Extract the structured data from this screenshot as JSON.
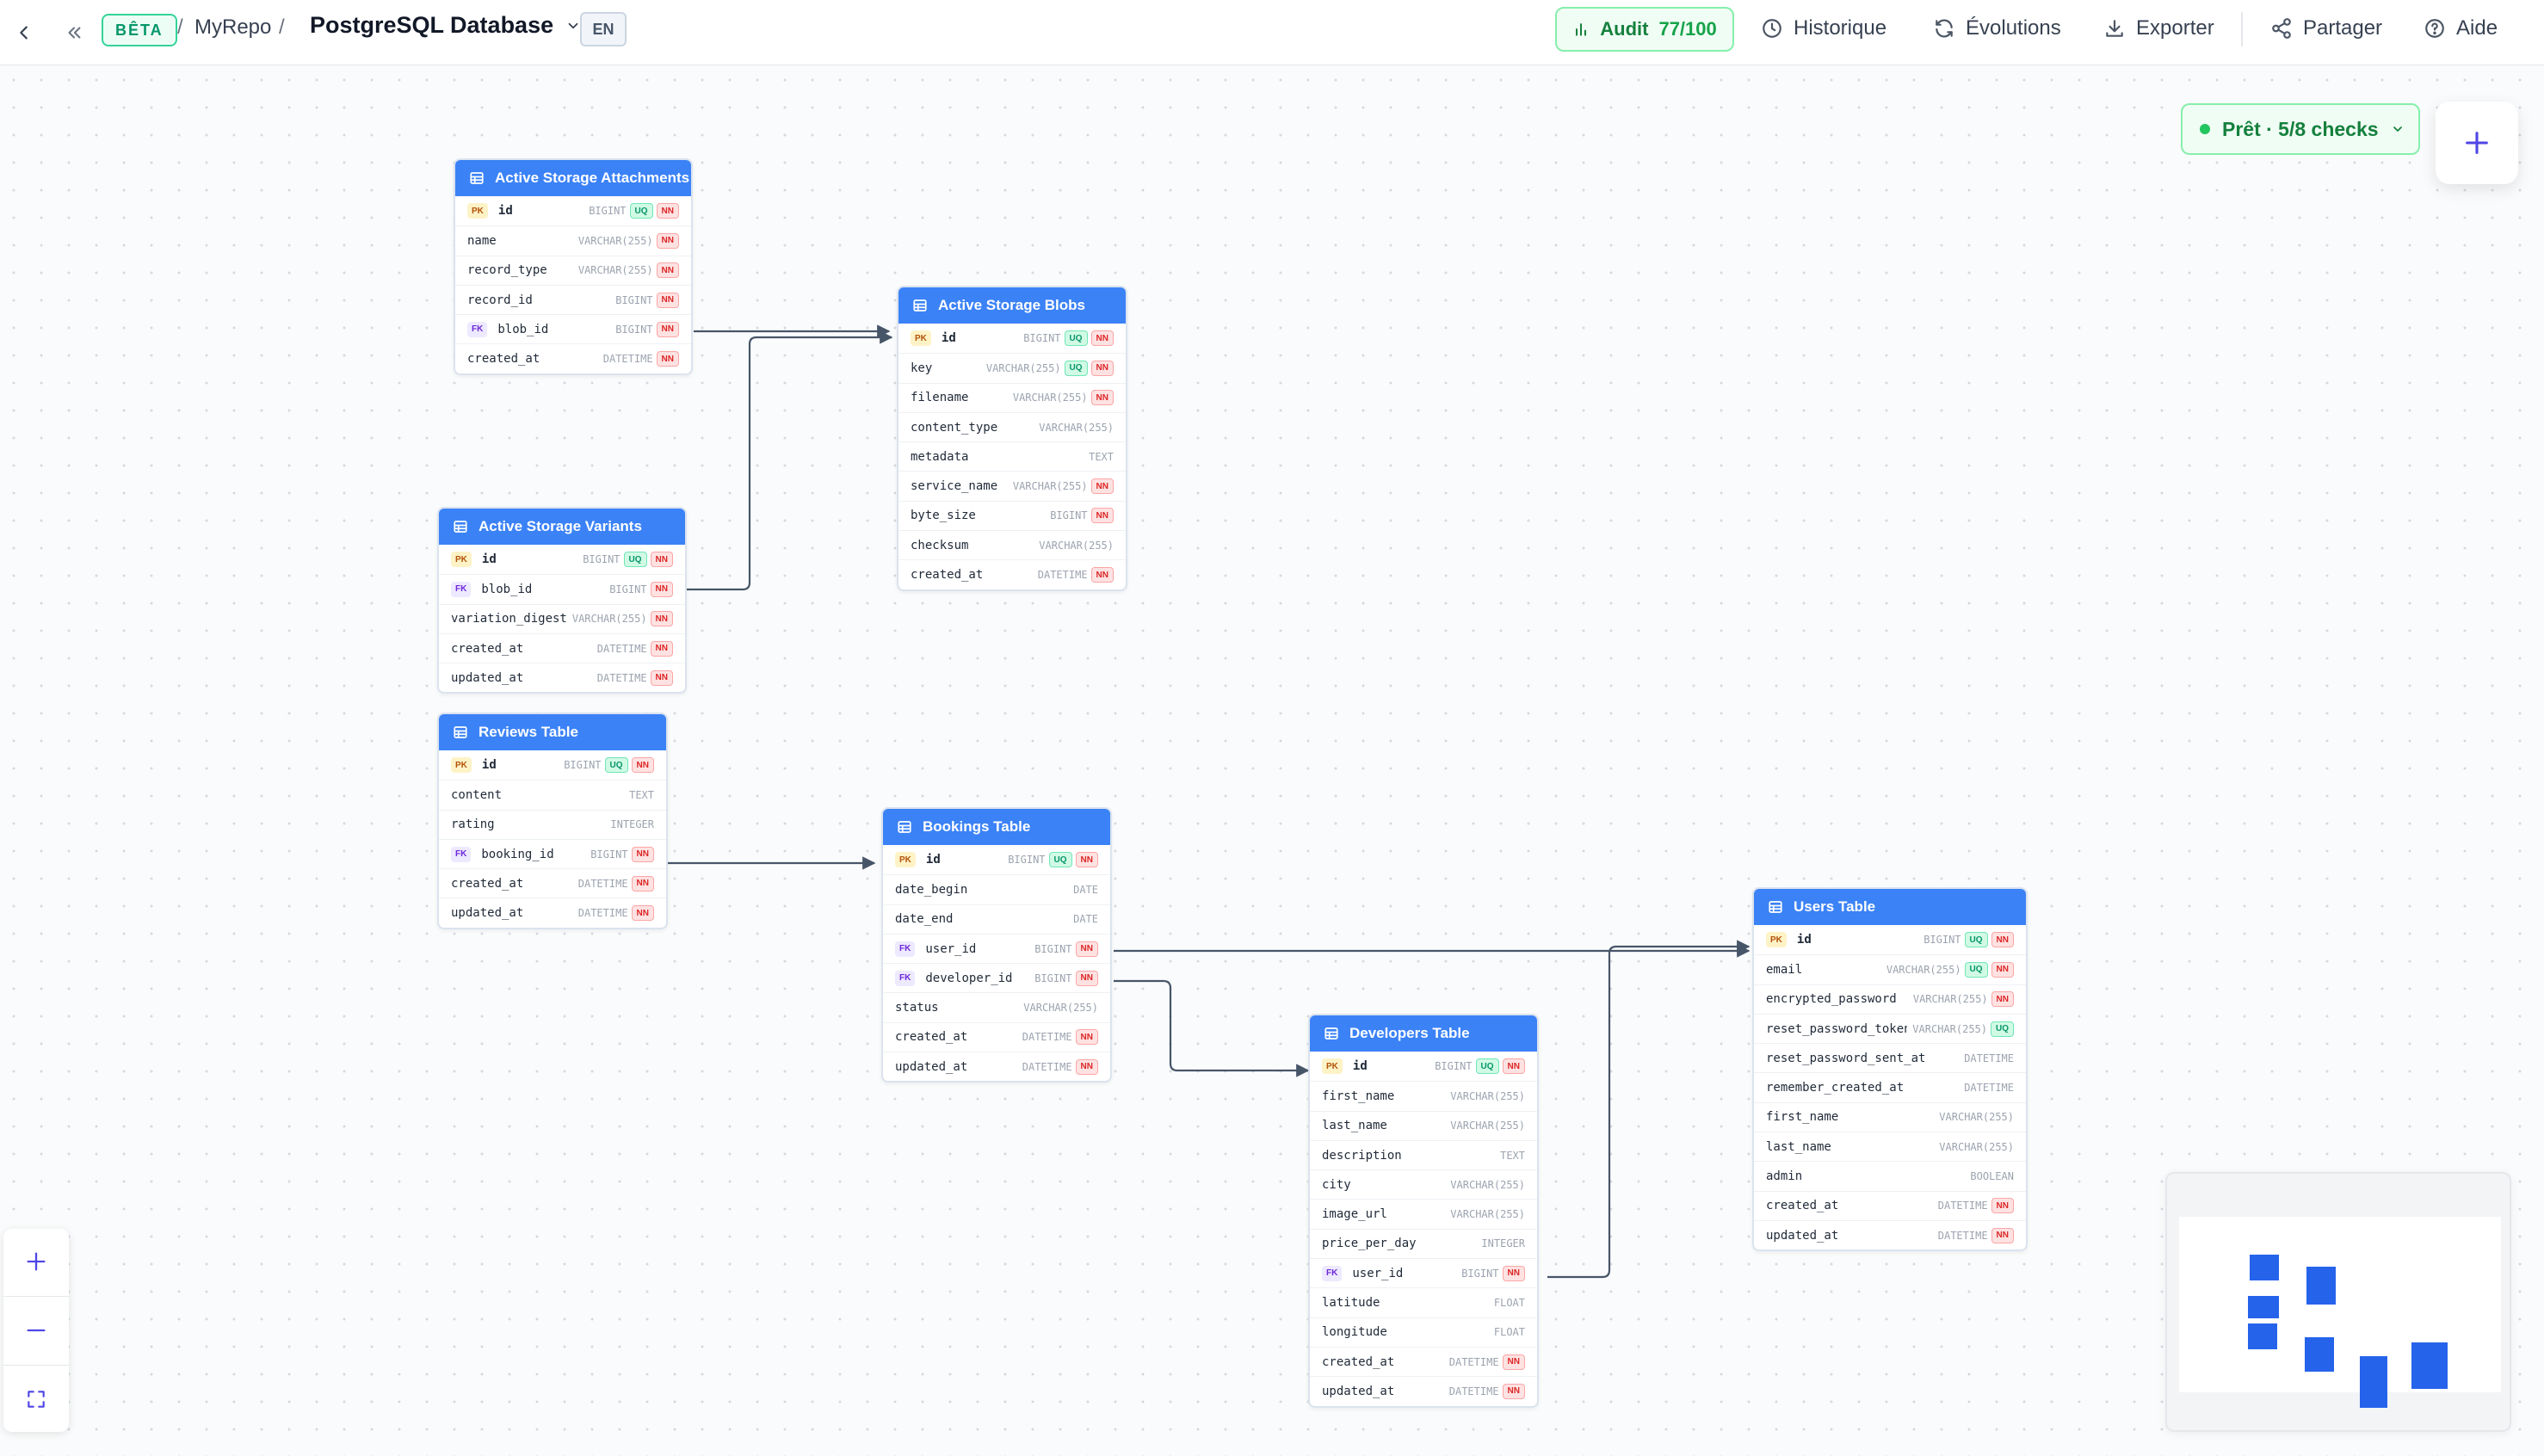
{
  "header": {
    "beta_label": "BÊTA",
    "separator": "/",
    "repo": "MyRepo",
    "database": "PostgreSQL Database",
    "language": "EN",
    "audit_label": "Audit",
    "audit_score": "77/100",
    "actions": {
      "history": "Historique",
      "evolutions": "Évolutions",
      "export": "Exporter",
      "share": "Partager",
      "help": "Aide"
    }
  },
  "status": {
    "label": "Prêt · 5/8 checks"
  },
  "colors": {
    "table_header": "#3b82f6",
    "edge": "#475569",
    "status_green": "#15803d",
    "accent": "#2563eb"
  },
  "tables": {
    "attachments": {
      "title": "Active Storage Attachments",
      "columns": [
        {
          "name": "id",
          "type": "BIGINT",
          "key": "PK",
          "badges": [
            "UQ",
            "NN"
          ]
        },
        {
          "name": "name",
          "type": "VARCHAR(255)",
          "key": "",
          "badges": [
            "NN"
          ]
        },
        {
          "name": "record_type",
          "type": "VARCHAR(255)",
          "key": "",
          "badges": [
            "NN"
          ]
        },
        {
          "name": "record_id",
          "type": "BIGINT",
          "key": "",
          "badges": [
            "NN"
          ]
        },
        {
          "name": "blob_id",
          "type": "BIGINT",
          "key": "FK",
          "badges": [
            "NN"
          ]
        },
        {
          "name": "created_at",
          "type": "DATETIME",
          "key": "",
          "badges": [
            "NN"
          ]
        }
      ]
    },
    "blobs": {
      "title": "Active Storage Blobs",
      "columns": [
        {
          "name": "id",
          "type": "BIGINT",
          "key": "PK",
          "badges": [
            "UQ",
            "NN"
          ]
        },
        {
          "name": "key",
          "type": "VARCHAR(255)",
          "key": "",
          "badges": [
            "UQ",
            "NN"
          ]
        },
        {
          "name": "filename",
          "type": "VARCHAR(255)",
          "key": "",
          "badges": [
            "NN"
          ]
        },
        {
          "name": "content_type",
          "type": "VARCHAR(255)",
          "key": "",
          "badges": []
        },
        {
          "name": "metadata",
          "type": "TEXT",
          "key": "",
          "badges": []
        },
        {
          "name": "service_name",
          "type": "VARCHAR(255)",
          "key": "",
          "badges": [
            "NN"
          ]
        },
        {
          "name": "byte_size",
          "type": "BIGINT",
          "key": "",
          "badges": [
            "NN"
          ]
        },
        {
          "name": "checksum",
          "type": "VARCHAR(255)",
          "key": "",
          "badges": []
        },
        {
          "name": "created_at",
          "type": "DATETIME",
          "key": "",
          "badges": [
            "NN"
          ]
        }
      ]
    },
    "variants": {
      "title": "Active Storage Variants",
      "columns": [
        {
          "name": "id",
          "type": "BIGINT",
          "key": "PK",
          "badges": [
            "UQ",
            "NN"
          ]
        },
        {
          "name": "blob_id",
          "type": "BIGINT",
          "key": "FK",
          "badges": [
            "NN"
          ]
        },
        {
          "name": "variation_digest",
          "type": "VARCHAR(255)",
          "key": "",
          "badges": [
            "NN"
          ]
        },
        {
          "name": "created_at",
          "type": "DATETIME",
          "key": "",
          "badges": [
            "NN"
          ]
        },
        {
          "name": "updated_at",
          "type": "DATETIME",
          "key": "",
          "badges": [
            "NN"
          ]
        }
      ]
    },
    "reviews": {
      "title": "Reviews Table",
      "columns": [
        {
          "name": "id",
          "type": "BIGINT",
          "key": "PK",
          "badges": [
            "UQ",
            "NN"
          ]
        },
        {
          "name": "content",
          "type": "TEXT",
          "key": "",
          "badges": []
        },
        {
          "name": "rating",
          "type": "INTEGER",
          "key": "",
          "badges": []
        },
        {
          "name": "booking_id",
          "type": "BIGINT",
          "key": "FK",
          "badges": [
            "NN"
          ]
        },
        {
          "name": "created_at",
          "type": "DATETIME",
          "key": "",
          "badges": [
            "NN"
          ]
        },
        {
          "name": "updated_at",
          "type": "DATETIME",
          "key": "",
          "badges": [
            "NN"
          ]
        }
      ]
    },
    "bookings": {
      "title": "Bookings Table",
      "columns": [
        {
          "name": "id",
          "type": "BIGINT",
          "key": "PK",
          "badges": [
            "UQ",
            "NN"
          ]
        },
        {
          "name": "date_begin",
          "type": "DATE",
          "key": "",
          "badges": []
        },
        {
          "name": "date_end",
          "type": "DATE",
          "key": "",
          "badges": []
        },
        {
          "name": "user_id",
          "type": "BIGINT",
          "key": "FK",
          "badges": [
            "NN"
          ]
        },
        {
          "name": "developer_id",
          "type": "BIGINT",
          "key": "FK",
          "badges": [
            "NN"
          ]
        },
        {
          "name": "status",
          "type": "VARCHAR(255)",
          "key": "",
          "badges": []
        },
        {
          "name": "created_at",
          "type": "DATETIME",
          "key": "",
          "badges": [
            "NN"
          ]
        },
        {
          "name": "updated_at",
          "type": "DATETIME",
          "key": "",
          "badges": [
            "NN"
          ]
        }
      ]
    },
    "developers": {
      "title": "Developers Table",
      "columns": [
        {
          "name": "id",
          "type": "BIGINT",
          "key": "PK",
          "badges": [
            "UQ",
            "NN"
          ]
        },
        {
          "name": "first_name",
          "type": "VARCHAR(255)",
          "key": "",
          "badges": []
        },
        {
          "name": "last_name",
          "type": "VARCHAR(255)",
          "key": "",
          "badges": []
        },
        {
          "name": "description",
          "type": "TEXT",
          "key": "",
          "badges": []
        },
        {
          "name": "city",
          "type": "VARCHAR(255)",
          "key": "",
          "badges": []
        },
        {
          "name": "image_url",
          "type": "VARCHAR(255)",
          "key": "",
          "badges": []
        },
        {
          "name": "price_per_day",
          "type": "INTEGER",
          "key": "",
          "badges": []
        },
        {
          "name": "user_id",
          "type": "BIGINT",
          "key": "FK",
          "badges": [
            "NN"
          ]
        },
        {
          "name": "latitude",
          "type": "FLOAT",
          "key": "",
          "badges": []
        },
        {
          "name": "longitude",
          "type": "FLOAT",
          "key": "",
          "badges": []
        },
        {
          "name": "created_at",
          "type": "DATETIME",
          "key": "",
          "badges": [
            "NN"
          ]
        },
        {
          "name": "updated_at",
          "type": "DATETIME",
          "key": "",
          "badges": [
            "NN"
          ]
        }
      ]
    },
    "users": {
      "title": "Users Table",
      "columns": [
        {
          "name": "id",
          "type": "BIGINT",
          "key": "PK",
          "badges": [
            "UQ",
            "NN"
          ]
        },
        {
          "name": "email",
          "type": "VARCHAR(255)",
          "key": "",
          "badges": [
            "UQ",
            "NN"
          ]
        },
        {
          "name": "encrypted_password",
          "type": "VARCHAR(255)",
          "key": "",
          "badges": [
            "NN"
          ]
        },
        {
          "name": "reset_password_token",
          "type": "VARCHAR(255)",
          "key": "",
          "badges": [
            "UQ"
          ]
        },
        {
          "name": "reset_password_sent_at",
          "type": "DATETIME",
          "key": "",
          "badges": []
        },
        {
          "name": "remember_created_at",
          "type": "DATETIME",
          "key": "",
          "badges": []
        },
        {
          "name": "first_name",
          "type": "VARCHAR(255)",
          "key": "",
          "badges": []
        },
        {
          "name": "last_name",
          "type": "VARCHAR(255)",
          "key": "",
          "badges": []
        },
        {
          "name": "admin",
          "type": "BOOLEAN",
          "key": "",
          "badges": []
        },
        {
          "name": "created_at",
          "type": "DATETIME",
          "key": "",
          "badges": [
            "NN"
          ]
        },
        {
          "name": "updated_at",
          "type": "DATETIME",
          "key": "",
          "badges": [
            "NN"
          ]
        }
      ]
    }
  },
  "relations": [
    {
      "from": "attachments.blob_id",
      "to": "blobs.id"
    },
    {
      "from": "variants.blob_id",
      "to": "blobs.id"
    },
    {
      "from": "reviews.booking_id",
      "to": "bookings.id"
    },
    {
      "from": "bookings.user_id",
      "to": "users.id"
    },
    {
      "from": "bookings.developer_id",
      "to": "developers.id"
    },
    {
      "from": "developers.user_id",
      "to": "users.id"
    }
  ],
  "icons": {
    "back": "chevron-left-icon",
    "collapse": "double-chevron-left-icon",
    "db_dropdown": "chevron-down-icon",
    "audit": "bar-chart-icon",
    "history": "clock-icon",
    "evolutions": "refresh-icon",
    "export": "download-icon",
    "share": "share-icon",
    "help": "help-circle-icon",
    "table": "table-icon",
    "add": "plus-icon",
    "zoom_in": "plus-icon",
    "zoom_out": "minus-icon",
    "fit": "fit-view-icon"
  }
}
